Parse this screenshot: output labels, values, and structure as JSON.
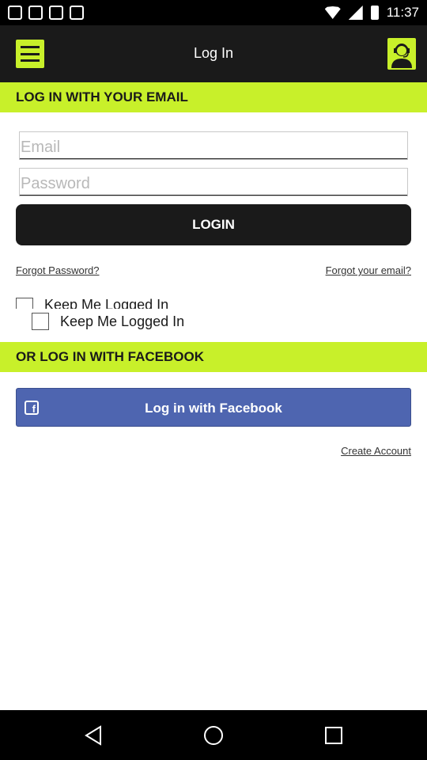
{
  "status_bar": {
    "time": "11:37"
  },
  "app_bar": {
    "title": "Log In",
    "menu_icon": "hamburger-menu-icon",
    "agent_icon": "support-agent-icon"
  },
  "email_section": {
    "header": "LOG IN WITH YOUR EMAIL",
    "email_placeholder": "Email",
    "email_value": "",
    "password_placeholder": "Password",
    "password_value": "",
    "login_label": "LOGIN",
    "forgot_password": "Forgot Password?",
    "forgot_email": "Forgot your email?",
    "keep_logged_in_clipped": "Keep Me Logged In",
    "keep_logged_in": "Keep Me Logged In"
  },
  "facebook_section": {
    "header": "OR LOG IN WITH FACEBOOK",
    "button_label": "Log in with Facebook",
    "icon": "facebook-icon"
  },
  "create_account": "Create Account",
  "colors": {
    "accent": "#c8f02a",
    "dark": "#1a1a1a",
    "facebook": "#4e65b0"
  }
}
